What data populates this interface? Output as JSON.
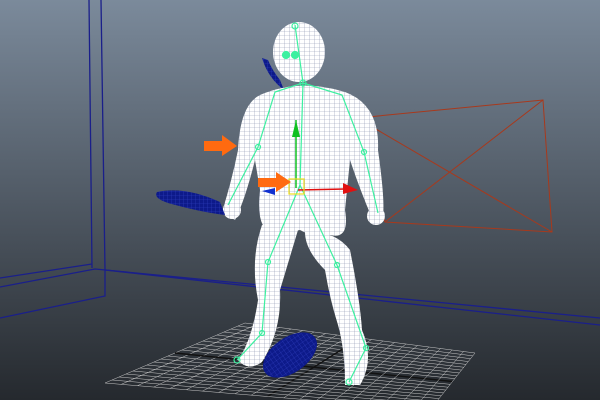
{
  "viewport": {
    "background_top": "#7b8a9b",
    "background_bottom": "#25292e",
    "wall_line_color": "#1a1f8a",
    "camera_frustum_color": "#a8391c",
    "ground_grid_color": "#c8c8c8",
    "mesh_wire_color": "#ffffff",
    "skeleton_color": "#3cf0a0",
    "prop_color": "#0d1a8a",
    "callout_arrow_color": "#ff6a10",
    "manipulator": {
      "x_axis": "#e01010",
      "y_axis": "#10c020",
      "z_axis": "#1030d0",
      "pivot": "#f0e020"
    }
  },
  "objects": [
    "character-wireframe",
    "skeleton",
    "sword",
    "shield",
    "back-fin",
    "camera-frustum",
    "ground-grid",
    "room-walls",
    "move-manipulator"
  ],
  "annotations": [
    {
      "icon": "arrow-right-icon",
      "target": "left-arm"
    },
    {
      "icon": "arrow-right-icon",
      "target": "pelvis-joint"
    }
  ]
}
